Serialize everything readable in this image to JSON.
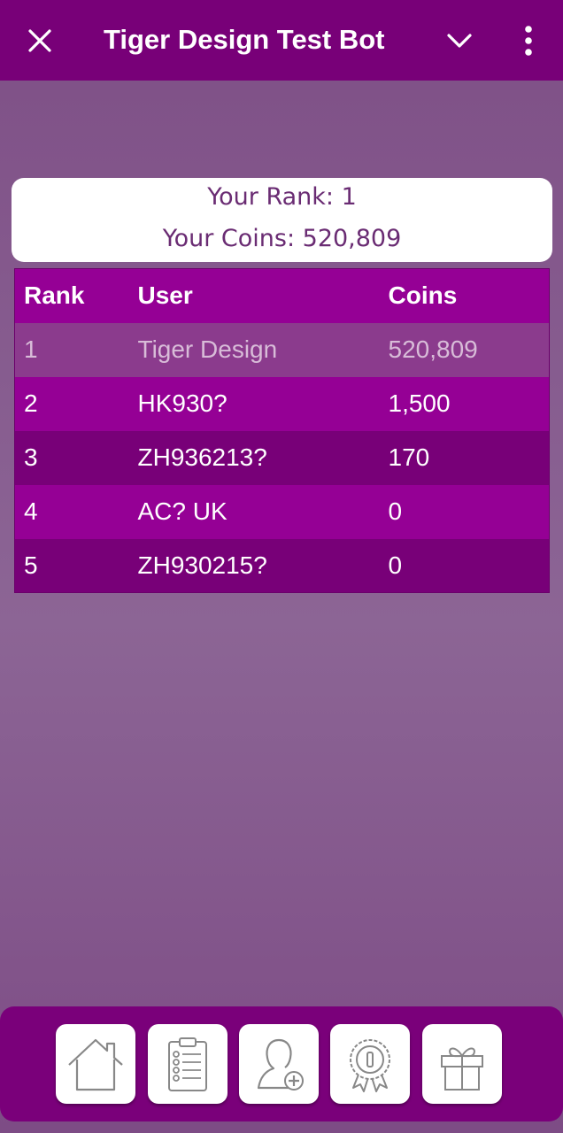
{
  "header": {
    "title": "Tiger Design Test Bot",
    "close_icon": "close-icon",
    "chevron_icon": "chevron-down-icon",
    "more_icon": "more-vert-icon"
  },
  "rank_card": {
    "rank_text": "Your Rank: 1",
    "coins_text": "Your Coins: 520,809"
  },
  "leaderboard": {
    "columns": [
      "Rank",
      "User",
      "Coins"
    ],
    "rows": [
      {
        "rank": "1",
        "user": "Tiger Design",
        "coins": "520,809"
      },
      {
        "rank": "2",
        "user": "HK930?",
        "coins": "1,500"
      },
      {
        "rank": "3",
        "user": "ZH936213?",
        "coins": "170"
      },
      {
        "rank": "4",
        "user": "AC? UK",
        "coins": "0"
      },
      {
        "rank": "5",
        "user": "ZH930215?",
        "coins": "0"
      }
    ]
  },
  "bottom_nav": {
    "items": [
      "home-icon",
      "clipboard-checklist-icon",
      "add-user-icon",
      "award-badge-icon",
      "gift-icon"
    ]
  },
  "colors": {
    "header_bg": "#780078",
    "row_primary": "#950095",
    "row_dark": "#780078",
    "row_current_user": "#8b3b8d",
    "card_text": "#6a2c73"
  }
}
